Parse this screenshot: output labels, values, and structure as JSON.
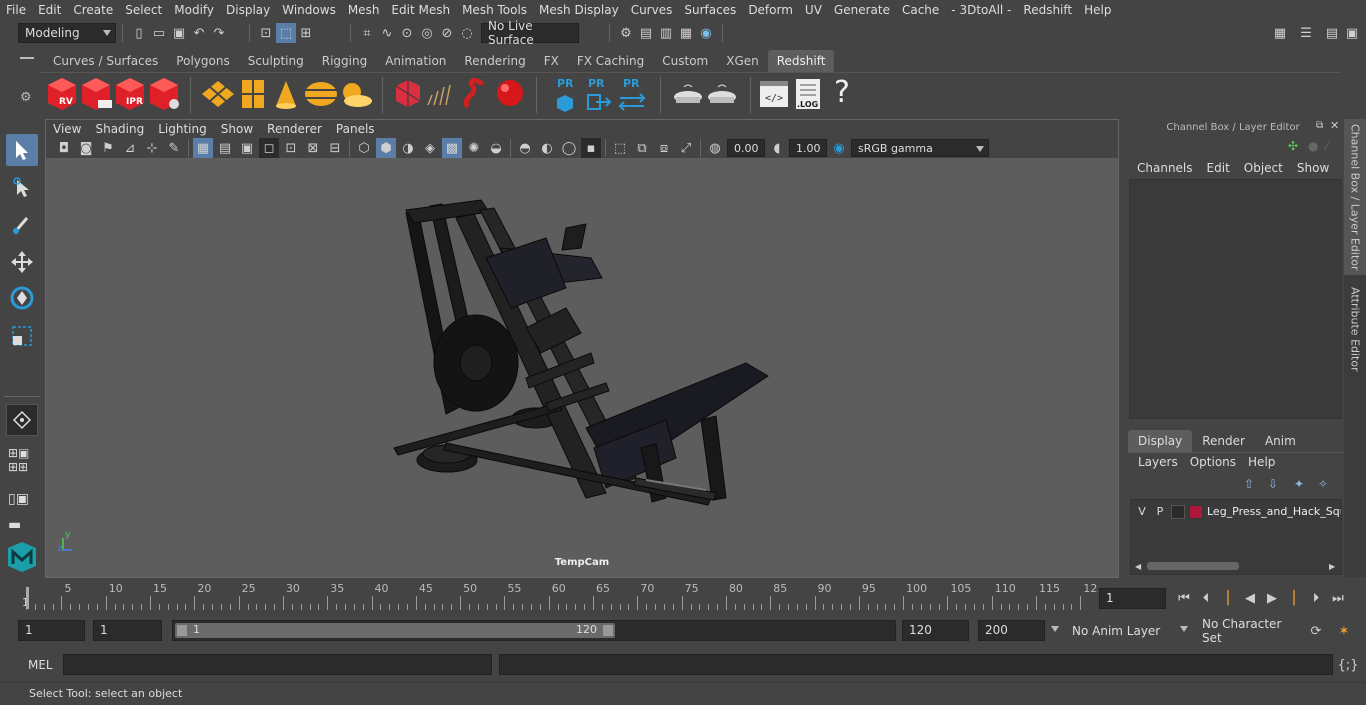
{
  "menubar": [
    "File",
    "Edit",
    "Create",
    "Select",
    "Modify",
    "Display",
    "Windows",
    "Mesh",
    "Edit Mesh",
    "Mesh Tools",
    "Mesh Display",
    "Curves",
    "Surfaces",
    "Deform",
    "UV",
    "Generate",
    "Cache",
    "- 3DtoAll -",
    "Redshift",
    "Help"
  ],
  "status": {
    "mode": "Modeling",
    "live_surface": "No Live Surface"
  },
  "shelf_tabs": [
    "Curves / Surfaces",
    "Polygons",
    "Sculpting",
    "Rigging",
    "Animation",
    "Rendering",
    "FX",
    "FX Caching",
    "Custom",
    "XGen",
    "Redshift"
  ],
  "shelf_labels": {
    "rv": "RV",
    "ipr": "IPR",
    "pr1": "PR",
    "pr2": "PR",
    "pr3": "PR",
    "log": ".LOG",
    "help": "?"
  },
  "panel_menu": [
    "View",
    "Shading",
    "Lighting",
    "Show",
    "Renderer",
    "Panels"
  ],
  "panel_fields": {
    "exposure": "0.00",
    "gamma": "1.00",
    "colorspace": "sRGB gamma"
  },
  "viewport": {
    "camera": "TempCam",
    "axis_y": "y",
    "axis_z": "z"
  },
  "channel_box": {
    "title": "Channel Box / Layer Editor",
    "menu": [
      "Channels",
      "Edit",
      "Object",
      "Show"
    ]
  },
  "layer_editor": {
    "tabs": [
      "Display",
      "Render",
      "Anim"
    ],
    "menu": [
      "Layers",
      "Options",
      "Help"
    ],
    "layer": {
      "v": "V",
      "p": "P",
      "name": "Leg_Press_and_Hack_Squ",
      "color": "#b0183a"
    }
  },
  "side_tabs": [
    "Channel Box / Layer Editor",
    "Attribute Editor"
  ],
  "timeline": {
    "ticks": [
      "5",
      "10",
      "15",
      "20",
      "25",
      "30",
      "35",
      "40",
      "45",
      "50",
      "55",
      "60",
      "65",
      "70",
      "75",
      "80",
      "85",
      "90",
      "95",
      "100",
      "105",
      "110",
      "115",
      "12"
    ],
    "start_label": "1",
    "current": "1"
  },
  "range": {
    "start": "1",
    "start2": "1",
    "slider_start": "1",
    "slider_end": "120",
    "end": "120",
    "end2": "200",
    "anim_layer": "No Anim Layer",
    "char_set": "No Character Set"
  },
  "cmd": {
    "lang": "MEL"
  },
  "help": {
    "text": "Select Tool: select an object"
  }
}
